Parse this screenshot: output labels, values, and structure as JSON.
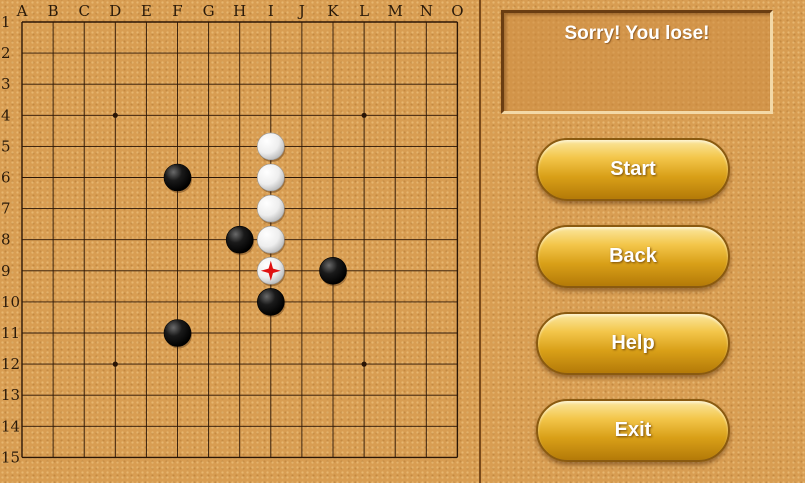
{
  "board": {
    "column_labels": [
      "A",
      "B",
      "C",
      "D",
      "E",
      "F",
      "G",
      "H",
      "I",
      "J",
      "K",
      "L",
      "M",
      "N",
      "O"
    ],
    "row_labels": [
      "1",
      "2",
      "3",
      "4",
      "5",
      "6",
      "7",
      "8",
      "9",
      "10",
      "11",
      "12",
      "13",
      "14",
      "15"
    ],
    "star_points": [
      "D4",
      "L4",
      "D12",
      "L12"
    ],
    "stones": [
      {
        "color": "white",
        "point": "I5"
      },
      {
        "color": "white",
        "point": "I6"
      },
      {
        "color": "white",
        "point": "I7"
      },
      {
        "color": "white",
        "point": "I8"
      },
      {
        "color": "white",
        "point": "I9",
        "last_move": true
      },
      {
        "color": "black",
        "point": "F6"
      },
      {
        "color": "black",
        "point": "H8"
      },
      {
        "color": "black",
        "point": "K9"
      },
      {
        "color": "black",
        "point": "I10"
      },
      {
        "color": "black",
        "point": "F11"
      }
    ]
  },
  "status": {
    "message": "Sorry! You lose!"
  },
  "buttons": {
    "start": "Start",
    "back": "Back",
    "help": "Help",
    "exit": "Exit"
  },
  "colors": {
    "line": "#2a1505",
    "black_stone": "#111111",
    "white_stone": "#f2f2f2",
    "last_move_marker": "#e01010",
    "button_gold": "#e0aa22"
  }
}
